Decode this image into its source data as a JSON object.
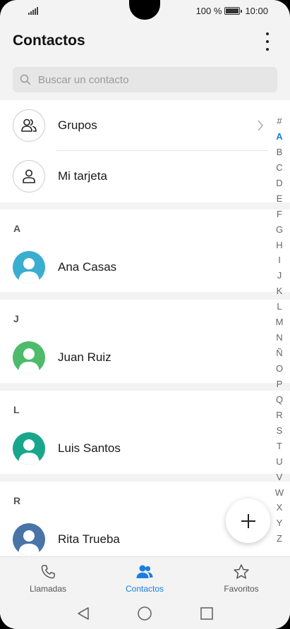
{
  "status_bar": {
    "battery_text": "100 %",
    "time": "10:00"
  },
  "header": {
    "title": "Contactos"
  },
  "search": {
    "placeholder": "Buscar un contacto"
  },
  "top_items": [
    {
      "label": "Grupos",
      "icon": "group-icon"
    },
    {
      "label": "Mi tarjeta",
      "icon": "person-icon"
    }
  ],
  "sections": [
    {
      "letter": "A",
      "contacts": [
        {
          "name": "Ana Casas",
          "color": "#3aaed1"
        }
      ]
    },
    {
      "letter": "J",
      "contacts": [
        {
          "name": "Juan Ruiz",
          "color": "#4dbb6a"
        }
      ]
    },
    {
      "letter": "L",
      "contacts": [
        {
          "name": "Luis Santos",
          "color": "#1aa68c"
        }
      ]
    },
    {
      "letter": "R",
      "contacts": [
        {
          "name": "Rita Trueba",
          "color": "#4a74a8"
        }
      ]
    }
  ],
  "alphabet": [
    "#",
    "A",
    "B",
    "C",
    "D",
    "E",
    "F",
    "G",
    "H",
    "I",
    "J",
    "K",
    "L",
    "M",
    "N",
    "Ñ",
    "O",
    "P",
    "Q",
    "R",
    "S",
    "T",
    "U",
    "V",
    "W",
    "X",
    "Y",
    "Z"
  ],
  "alphabet_active": "A",
  "bottom_nav": [
    {
      "label": "Llamadas",
      "icon": "phone-icon",
      "active": false
    },
    {
      "label": "Contactos",
      "icon": "contacts-icon",
      "active": true
    },
    {
      "label": "Favoritos",
      "icon": "star-icon",
      "active": false
    }
  ],
  "colors": {
    "accent": "#1a7fe0",
    "background": "#f3f3f3"
  }
}
